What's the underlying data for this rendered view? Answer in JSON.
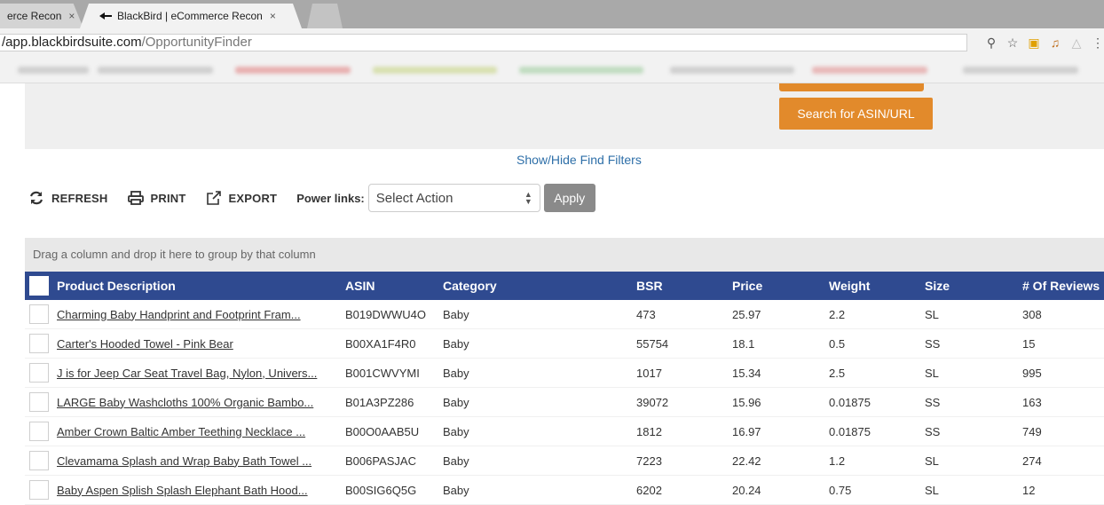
{
  "browser": {
    "tabs": [
      {
        "label": "erce Recon",
        "close": "×"
      },
      {
        "label": "BlackBird | eCommerce Recon",
        "close": "×"
      }
    ],
    "url_host": "/app.blackbirdsuite.com",
    "url_path": "/OpportunityFinder"
  },
  "filters": {
    "search_button": "Search for ASIN/URL",
    "toggle_link": "Show/Hide Find Filters"
  },
  "toolbar": {
    "refresh": "REFRESH",
    "print": "PRINT",
    "export": "EXPORT",
    "power_links_label": "Power links:",
    "select_value": "Select Action",
    "apply": "Apply"
  },
  "grid": {
    "group_hint": "Drag a column and drop it here to group by that column",
    "columns": {
      "description": "Product Description",
      "asin": "ASIN",
      "category": "Category",
      "bsr": "BSR",
      "price": "Price",
      "weight": "Weight",
      "size": "Size",
      "reviews": "# Of Reviews"
    },
    "rows": [
      {
        "description": "Charming Baby Handprint and Footprint Fram...",
        "asin": "B019DWWU4O",
        "category": "Baby",
        "bsr": "473",
        "price": "25.97",
        "weight": "2.2",
        "size": "SL",
        "reviews": "308"
      },
      {
        "description": "Carter's Hooded Towel - Pink Bear",
        "asin": "B00XA1F4R0",
        "category": "Baby",
        "bsr": "55754",
        "price": "18.1",
        "weight": "0.5",
        "size": "SS",
        "reviews": "15"
      },
      {
        "description": "J is for Jeep Car Seat Travel Bag, Nylon, Univers...",
        "asin": "B001CWVYMI",
        "category": "Baby",
        "bsr": "1017",
        "price": "15.34",
        "weight": "2.5",
        "size": "SL",
        "reviews": "995"
      },
      {
        "description": "LARGE Baby Washcloths 100% Organic Bambo...",
        "asin": "B01A3PZ286",
        "category": "Baby",
        "bsr": "39072",
        "price": "15.96",
        "weight": "0.01875",
        "size": "SS",
        "reviews": "163"
      },
      {
        "description": "Amber Crown Baltic Amber Teething Necklace ...",
        "asin": "B00O0AAB5U",
        "category": "Baby",
        "bsr": "1812",
        "price": "16.97",
        "weight": "0.01875",
        "size": "SS",
        "reviews": "749"
      },
      {
        "description": "Clevamama Splash and Wrap Baby Bath Towel ...",
        "asin": "B006PASJAC",
        "category": "Baby",
        "bsr": "7223",
        "price": "22.42",
        "weight": "1.2",
        "size": "SL",
        "reviews": "274"
      },
      {
        "description": "Baby Aspen Splish Splash Elephant Bath Hood...",
        "asin": "B00SIG6Q5G",
        "category": "Baby",
        "bsr": "6202",
        "price": "20.24",
        "weight": "0.75",
        "size": "SL",
        "reviews": "12"
      }
    ]
  },
  "colors": {
    "header": "#2f4a90",
    "accent_orange": "#e28a2b",
    "link": "#2e6fa8"
  }
}
